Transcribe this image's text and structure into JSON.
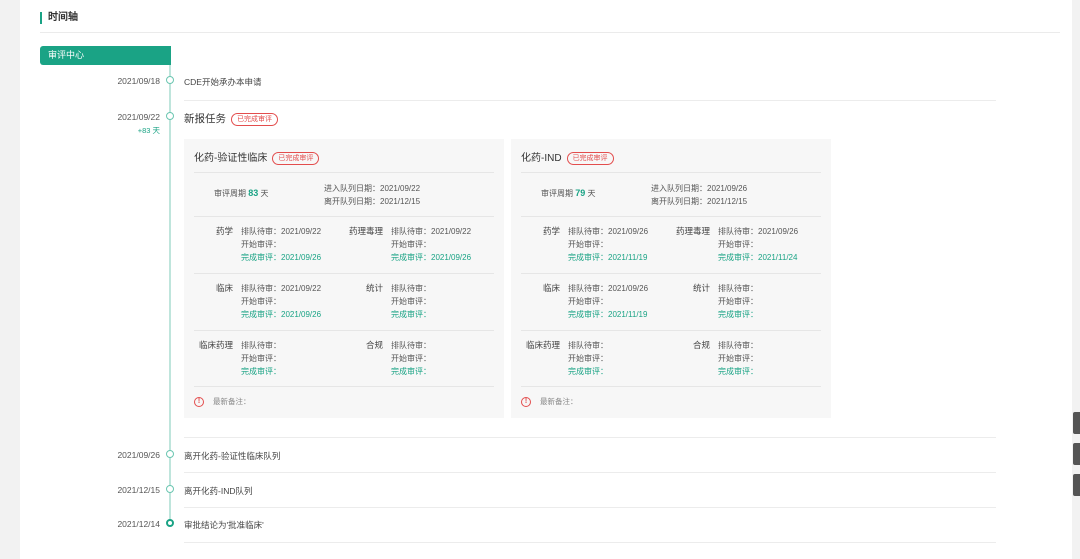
{
  "header": {
    "title": "时间轴"
  },
  "center_tag": "审评中心",
  "events": [
    {
      "date": "2021/09/18",
      "text": "CDE开始承办本申请"
    },
    {
      "date": "2021/09/22",
      "sub": "+83 天",
      "text": "新报任务",
      "badge": "已完成审评"
    },
    {
      "date": "2021/09/26",
      "text": "离开化药-验证性临床队列"
    },
    {
      "date": "2021/12/15",
      "text": "离开化药-IND队列"
    },
    {
      "date": "2021/12/14",
      "text": "审批结论为'批准临床'"
    }
  ],
  "cards": [
    {
      "title": "化药-验证性临床",
      "badge": "已完成审评",
      "period_label": "审评周期",
      "period_days": "83",
      "period_unit": "天",
      "enter_line": "进入队列日期：2021/09/22",
      "leave_line": "离开队列日期：2021/12/15",
      "disciplines": [
        {
          "name": "药学",
          "queue": "排队待审：2021/09/22",
          "start": "开始审评：",
          "done": "完成审评：2021/09/26"
        },
        {
          "name": "药理毒理",
          "queue": "排队待审：2021/09/22",
          "start": "开始审评：",
          "done": "完成审评：2021/09/26"
        },
        {
          "name": "临床",
          "queue": "排队待审：2021/09/22",
          "start": "开始审评：",
          "done": "完成审评：2021/09/26"
        },
        {
          "name": "统计",
          "queue": "排队待审：",
          "start": "开始审评：",
          "done": "完成审评："
        },
        {
          "name": "临床药理",
          "queue": "排队待审：",
          "start": "开始审评：",
          "done": "完成审评："
        },
        {
          "name": "合规",
          "queue": "排队待审：",
          "start": "开始审评：",
          "done": "完成审评："
        }
      ],
      "note": "最新备注："
    },
    {
      "title": "化药-IND",
      "badge": "已完成审评",
      "period_label": "审评周期",
      "period_days": "79",
      "period_unit": "天",
      "enter_line": "进入队列日期：2021/09/26",
      "leave_line": "离开队列日期：2021/12/15",
      "disciplines": [
        {
          "name": "药学",
          "queue": "排队待审：2021/09/26",
          "start": "开始审评：",
          "done": "完成审评：2021/11/19"
        },
        {
          "name": "药理毒理",
          "queue": "排队待审：2021/09/26",
          "start": "开始审评：",
          "done": "完成审评：2021/11/24"
        },
        {
          "name": "临床",
          "queue": "排队待审：2021/09/26",
          "start": "开始审评：",
          "done": "完成审评：2021/11/19"
        },
        {
          "name": "统计",
          "queue": "排队待审：",
          "start": "开始审评：",
          "done": "完成审评："
        },
        {
          "name": "临床药理",
          "queue": "排队待审：",
          "start": "开始审评：",
          "done": "完成审评："
        },
        {
          "name": "合规",
          "queue": "排队待审：",
          "start": "开始审评：",
          "done": "完成审评："
        }
      ],
      "note": "最新备注："
    }
  ],
  "colors": {
    "accent": "#1aa385",
    "badge_red": "#e34d4d"
  }
}
